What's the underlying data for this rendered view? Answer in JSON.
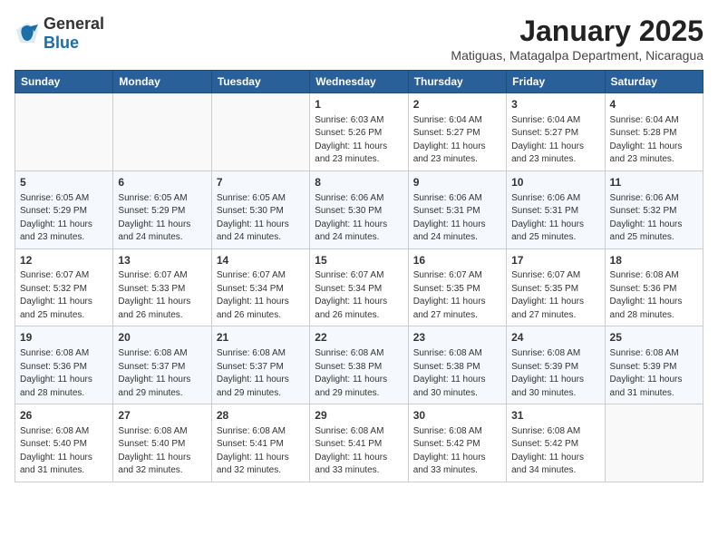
{
  "header": {
    "logo_general": "General",
    "logo_blue": "Blue",
    "month_title": "January 2025",
    "subtitle": "Matiguas, Matagalpa Department, Nicaragua"
  },
  "weekdays": [
    "Sunday",
    "Monday",
    "Tuesday",
    "Wednesday",
    "Thursday",
    "Friday",
    "Saturday"
  ],
  "weeks": [
    [
      {
        "day": "",
        "sunrise": "",
        "sunset": "",
        "daylight": ""
      },
      {
        "day": "",
        "sunrise": "",
        "sunset": "",
        "daylight": ""
      },
      {
        "day": "",
        "sunrise": "",
        "sunset": "",
        "daylight": ""
      },
      {
        "day": "1",
        "sunrise": "Sunrise: 6:03 AM",
        "sunset": "Sunset: 5:26 PM",
        "daylight": "Daylight: 11 hours and 23 minutes."
      },
      {
        "day": "2",
        "sunrise": "Sunrise: 6:04 AM",
        "sunset": "Sunset: 5:27 PM",
        "daylight": "Daylight: 11 hours and 23 minutes."
      },
      {
        "day": "3",
        "sunrise": "Sunrise: 6:04 AM",
        "sunset": "Sunset: 5:27 PM",
        "daylight": "Daylight: 11 hours and 23 minutes."
      },
      {
        "day": "4",
        "sunrise": "Sunrise: 6:04 AM",
        "sunset": "Sunset: 5:28 PM",
        "daylight": "Daylight: 11 hours and 23 minutes."
      }
    ],
    [
      {
        "day": "5",
        "sunrise": "Sunrise: 6:05 AM",
        "sunset": "Sunset: 5:29 PM",
        "daylight": "Daylight: 11 hours and 23 minutes."
      },
      {
        "day": "6",
        "sunrise": "Sunrise: 6:05 AM",
        "sunset": "Sunset: 5:29 PM",
        "daylight": "Daylight: 11 hours and 24 minutes."
      },
      {
        "day": "7",
        "sunrise": "Sunrise: 6:05 AM",
        "sunset": "Sunset: 5:30 PM",
        "daylight": "Daylight: 11 hours and 24 minutes."
      },
      {
        "day": "8",
        "sunrise": "Sunrise: 6:06 AM",
        "sunset": "Sunset: 5:30 PM",
        "daylight": "Daylight: 11 hours and 24 minutes."
      },
      {
        "day": "9",
        "sunrise": "Sunrise: 6:06 AM",
        "sunset": "Sunset: 5:31 PM",
        "daylight": "Daylight: 11 hours and 24 minutes."
      },
      {
        "day": "10",
        "sunrise": "Sunrise: 6:06 AM",
        "sunset": "Sunset: 5:31 PM",
        "daylight": "Daylight: 11 hours and 25 minutes."
      },
      {
        "day": "11",
        "sunrise": "Sunrise: 6:06 AM",
        "sunset": "Sunset: 5:32 PM",
        "daylight": "Daylight: 11 hours and 25 minutes."
      }
    ],
    [
      {
        "day": "12",
        "sunrise": "Sunrise: 6:07 AM",
        "sunset": "Sunset: 5:32 PM",
        "daylight": "Daylight: 11 hours and 25 minutes."
      },
      {
        "day": "13",
        "sunrise": "Sunrise: 6:07 AM",
        "sunset": "Sunset: 5:33 PM",
        "daylight": "Daylight: 11 hours and 26 minutes."
      },
      {
        "day": "14",
        "sunrise": "Sunrise: 6:07 AM",
        "sunset": "Sunset: 5:34 PM",
        "daylight": "Daylight: 11 hours and 26 minutes."
      },
      {
        "day": "15",
        "sunrise": "Sunrise: 6:07 AM",
        "sunset": "Sunset: 5:34 PM",
        "daylight": "Daylight: 11 hours and 26 minutes."
      },
      {
        "day": "16",
        "sunrise": "Sunrise: 6:07 AM",
        "sunset": "Sunset: 5:35 PM",
        "daylight": "Daylight: 11 hours and 27 minutes."
      },
      {
        "day": "17",
        "sunrise": "Sunrise: 6:07 AM",
        "sunset": "Sunset: 5:35 PM",
        "daylight": "Daylight: 11 hours and 27 minutes."
      },
      {
        "day": "18",
        "sunrise": "Sunrise: 6:08 AM",
        "sunset": "Sunset: 5:36 PM",
        "daylight": "Daylight: 11 hours and 28 minutes."
      }
    ],
    [
      {
        "day": "19",
        "sunrise": "Sunrise: 6:08 AM",
        "sunset": "Sunset: 5:36 PM",
        "daylight": "Daylight: 11 hours and 28 minutes."
      },
      {
        "day": "20",
        "sunrise": "Sunrise: 6:08 AM",
        "sunset": "Sunset: 5:37 PM",
        "daylight": "Daylight: 11 hours and 29 minutes."
      },
      {
        "day": "21",
        "sunrise": "Sunrise: 6:08 AM",
        "sunset": "Sunset: 5:37 PM",
        "daylight": "Daylight: 11 hours and 29 minutes."
      },
      {
        "day": "22",
        "sunrise": "Sunrise: 6:08 AM",
        "sunset": "Sunset: 5:38 PM",
        "daylight": "Daylight: 11 hours and 29 minutes."
      },
      {
        "day": "23",
        "sunrise": "Sunrise: 6:08 AM",
        "sunset": "Sunset: 5:38 PM",
        "daylight": "Daylight: 11 hours and 30 minutes."
      },
      {
        "day": "24",
        "sunrise": "Sunrise: 6:08 AM",
        "sunset": "Sunset: 5:39 PM",
        "daylight": "Daylight: 11 hours and 30 minutes."
      },
      {
        "day": "25",
        "sunrise": "Sunrise: 6:08 AM",
        "sunset": "Sunset: 5:39 PM",
        "daylight": "Daylight: 11 hours and 31 minutes."
      }
    ],
    [
      {
        "day": "26",
        "sunrise": "Sunrise: 6:08 AM",
        "sunset": "Sunset: 5:40 PM",
        "daylight": "Daylight: 11 hours and 31 minutes."
      },
      {
        "day": "27",
        "sunrise": "Sunrise: 6:08 AM",
        "sunset": "Sunset: 5:40 PM",
        "daylight": "Daylight: 11 hours and 32 minutes."
      },
      {
        "day": "28",
        "sunrise": "Sunrise: 6:08 AM",
        "sunset": "Sunset: 5:41 PM",
        "daylight": "Daylight: 11 hours and 32 minutes."
      },
      {
        "day": "29",
        "sunrise": "Sunrise: 6:08 AM",
        "sunset": "Sunset: 5:41 PM",
        "daylight": "Daylight: 11 hours and 33 minutes."
      },
      {
        "day": "30",
        "sunrise": "Sunrise: 6:08 AM",
        "sunset": "Sunset: 5:42 PM",
        "daylight": "Daylight: 11 hours and 33 minutes."
      },
      {
        "day": "31",
        "sunrise": "Sunrise: 6:08 AM",
        "sunset": "Sunset: 5:42 PM",
        "daylight": "Daylight: 11 hours and 34 minutes."
      },
      {
        "day": "",
        "sunrise": "",
        "sunset": "",
        "daylight": ""
      }
    ]
  ]
}
